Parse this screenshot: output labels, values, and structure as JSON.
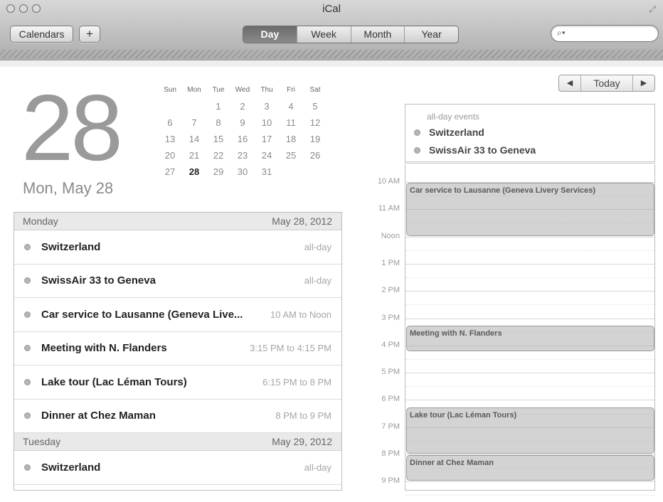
{
  "window": {
    "title": "iCal"
  },
  "toolbar": {
    "calendars_label": "Calendars",
    "add_label": "+",
    "views": [
      "Day",
      "Week",
      "Month",
      "Year"
    ],
    "active_view": "Day",
    "search_placeholder": ""
  },
  "date_header": {
    "day_number": "28",
    "date_label": "Mon, May 28"
  },
  "mini_calendar": {
    "weekdays": [
      "Sun",
      "Mon",
      "Tue",
      "Wed",
      "Thu",
      "Fri",
      "Sat"
    ],
    "weeks": [
      [
        "",
        "",
        "1",
        "2",
        "3",
        "4",
        "5"
      ],
      [
        "6",
        "7",
        "8",
        "9",
        "10",
        "11",
        "12"
      ],
      [
        "13",
        "14",
        "15",
        "16",
        "17",
        "18",
        "19"
      ],
      [
        "20",
        "21",
        "22",
        "23",
        "24",
        "25",
        "26"
      ],
      [
        "27",
        "28",
        "29",
        "30",
        "31",
        "",
        ""
      ]
    ],
    "selected": "28"
  },
  "event_list": {
    "monday": {
      "day": "Monday",
      "date": "May 28, 2012",
      "events": [
        {
          "title": "Switzerland",
          "time": "all-day"
        },
        {
          "title": "SwissAir 33 to Geneva",
          "time": "all-day"
        },
        {
          "title": "Car service to Lausanne (Geneva Live...",
          "time": "10 AM to Noon"
        },
        {
          "title": "Meeting with N. Flanders",
          "time": "3:15 PM to 4:15 PM"
        },
        {
          "title": "Lake tour (Lac Léman Tours)",
          "time": "6:15 PM to 8 PM"
        },
        {
          "title": "Dinner at Chez Maman",
          "time": "8 PM to 9 PM"
        }
      ]
    },
    "tuesday": {
      "day": "Tuesday",
      "date": "May 29, 2012",
      "events": [
        {
          "title": "Switzerland",
          "time": "all-day"
        }
      ]
    }
  },
  "day_nav": {
    "prev": "◀",
    "today": "Today",
    "next": "▶"
  },
  "day_view": {
    "allday_label": "all-day events",
    "allday_events": [
      "Switzerland",
      "SwissAir 33 to Geneva"
    ],
    "hours": [
      "10 AM",
      "11 AM",
      "Noon",
      "1 PM",
      "2 PM",
      "3 PM",
      "4 PM",
      "5 PM",
      "6 PM",
      "7 PM",
      "8 PM",
      "9 PM"
    ],
    "blocks": [
      {
        "title": "Car service to Lausanne (Geneva Livery Services)",
        "start": "10 AM",
        "end": "Noon"
      },
      {
        "title": "Meeting with N. Flanders",
        "start": "3:15 PM",
        "end": "4:15 PM"
      },
      {
        "title": "Lake tour (Lac Léman Tours)",
        "start": "6:15 PM",
        "end": "8 PM"
      },
      {
        "title": "Dinner at Chez Maman",
        "start": "8 PM",
        "end": "9 PM"
      }
    ]
  }
}
